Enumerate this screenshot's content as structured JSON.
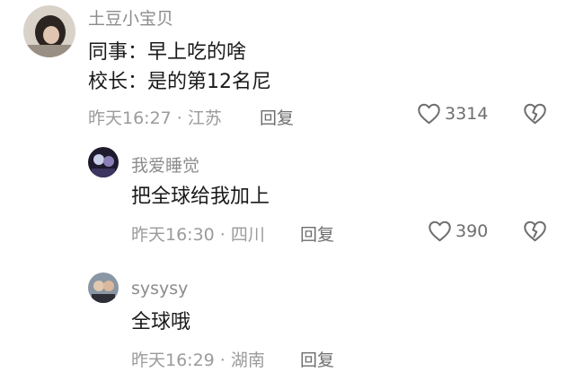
{
  "comments": [
    {
      "username": "土豆小宝贝",
      "lines": [
        "同事：早上吃的啥",
        "校长：是的第12名尼"
      ],
      "time": "昨天16:27",
      "location": "江苏",
      "reply_label": "回复",
      "like_count": "3314",
      "avatar_color": "#c9c2b8"
    },
    {
      "username": "我爱睡觉",
      "lines": [
        "把全球给我加上"
      ],
      "time": "昨天16:30",
      "location": "四川",
      "reply_label": "回复",
      "like_count": "390",
      "avatar_color": "#2a2438"
    },
    {
      "username": "sysysy",
      "lines": [
        "全球哦"
      ],
      "time": "昨天16:29",
      "location": "湖南",
      "reply_label": "回复",
      "avatar_color": "#6f7c8a"
    }
  ],
  "separator": "·",
  "icons": {
    "like": "heart-outline-icon",
    "dislike": "broken-heart-icon"
  }
}
